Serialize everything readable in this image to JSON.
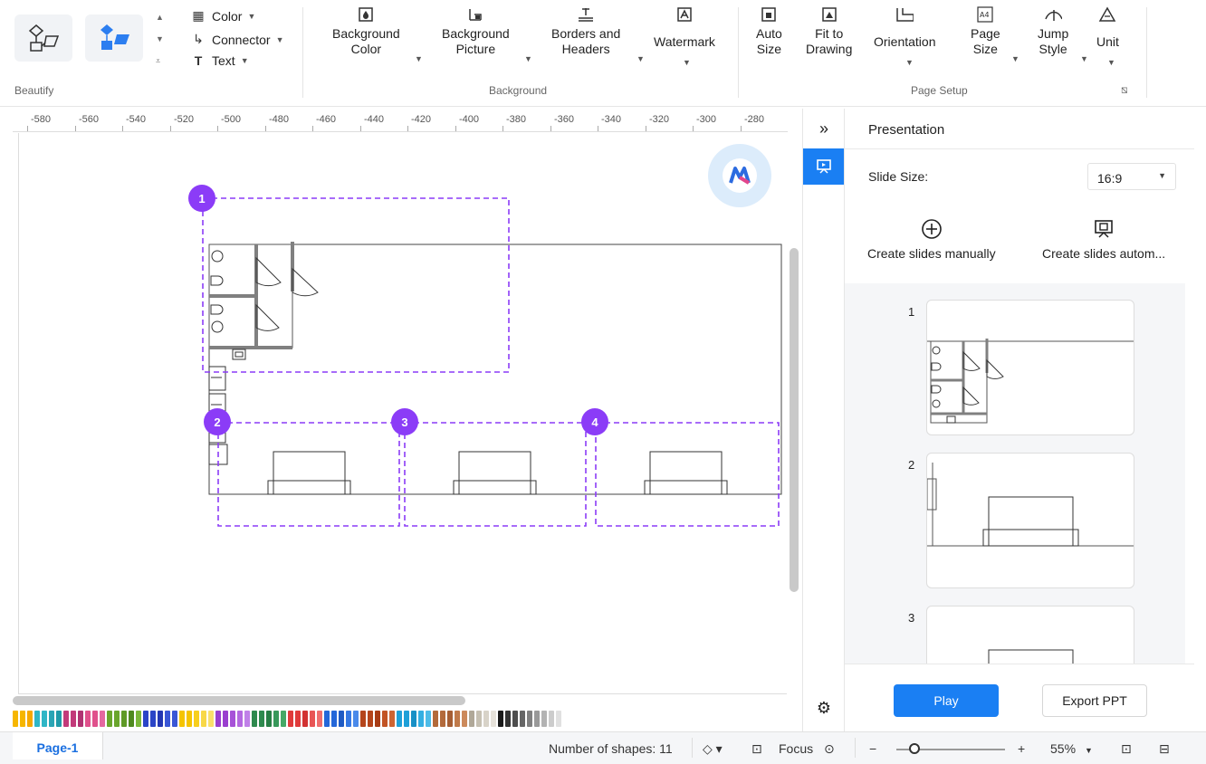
{
  "ribbon": {
    "styles": {
      "color_label": "Color",
      "connector_label": "Connector",
      "text_label": "Text"
    },
    "groups": {
      "beautify": "Beautify",
      "background": "Background",
      "page_setup": "Page Setup"
    },
    "background": {
      "bg_color_line1": "Background",
      "bg_color_line2": "Color",
      "bg_picture_line1": "Background",
      "bg_picture_line2": "Picture",
      "borders_line1": "Borders and",
      "borders_line2": "Headers",
      "watermark": "Watermark"
    },
    "page_setup": {
      "auto_size_line1": "Auto",
      "auto_size_line2": "Size",
      "fit_line1": "Fit to",
      "fit_line2": "Drawing",
      "orientation": "Orientation",
      "page_size_line1": "Page",
      "page_size_line2": "Size",
      "jump_line1": "Jump",
      "jump_line2": "Style",
      "unit": "Unit"
    }
  },
  "ruler": {
    "labels": [
      "-580",
      "-560",
      "-540",
      "-520",
      "-500",
      "-480",
      "-460",
      "-440",
      "-420",
      "-400",
      "-380",
      "-360",
      "-340",
      "-320",
      "-300",
      "-280"
    ]
  },
  "canvas": {
    "frames": [
      "1",
      "2",
      "3",
      "4"
    ],
    "frame_color": "#8b3cf7"
  },
  "palette": [
    "#f6b600",
    "#f6b600",
    "#f6a800",
    "#2fb6c6",
    "#2fb6c6",
    "#2aa5b5",
    "#209aa9",
    "#c23a7a",
    "#c23a7a",
    "#b13372",
    "#e0518c",
    "#e0518c",
    "#e468a0",
    "#6aa62c",
    "#6aa62c",
    "#5f9a26",
    "#4f8a1f",
    "#7bb83a",
    "#2b45c7",
    "#2b45c7",
    "#2437b3",
    "#3a57d6",
    "#3a57d6",
    "#f5c400",
    "#f5c400",
    "#f7cf1e",
    "#f8d847",
    "#f9e06b",
    "#9a3fcf",
    "#9a3fcf",
    "#a751d8",
    "#b468e0",
    "#c080e8",
    "#2e8a4e",
    "#2e8a4e",
    "#277e45",
    "#37985a",
    "#45a866",
    "#e03b3b",
    "#e03b3b",
    "#d23232",
    "#e85555",
    "#ef6e6e",
    "#2467d9",
    "#2467d9",
    "#1f5bc4",
    "#3679e3",
    "#4a8aea",
    "#b5451b",
    "#b5451b",
    "#a83c15",
    "#c25424",
    "#cd6432",
    "#1ea0d8",
    "#1ea0d8",
    "#1890c6",
    "#34afe2",
    "#4dbce8",
    "#b36a3b",
    "#b36a3b",
    "#a65e33",
    "#c07a4a",
    "#cc8a5c",
    "#b0a898",
    "#c6c0b2",
    "#d8d3c8",
    "#e6e2da",
    "#1a1a1a",
    "#333333",
    "#4d4d4d",
    "#666666",
    "#808080",
    "#999999",
    "#b3b3b3",
    "#cccccc",
    "#e0e0e0"
  ],
  "status": {
    "page_tab": "Page-1",
    "shape_count": "Number of shapes: 11",
    "focus": "Focus",
    "zoom": "55%"
  },
  "panel": {
    "title": "Presentation",
    "slide_size_label": "Slide Size:",
    "slide_size_value": "16:9",
    "create_manual": "Create slides manually",
    "create_auto": "Create slides autom...",
    "slides": [
      "1",
      "2",
      "3"
    ],
    "play": "Play",
    "export": "Export PPT"
  },
  "colors": {
    "accent": "#1a7ff3",
    "frame_purple": "#8b3cf7",
    "wall_gray": "#808080"
  }
}
